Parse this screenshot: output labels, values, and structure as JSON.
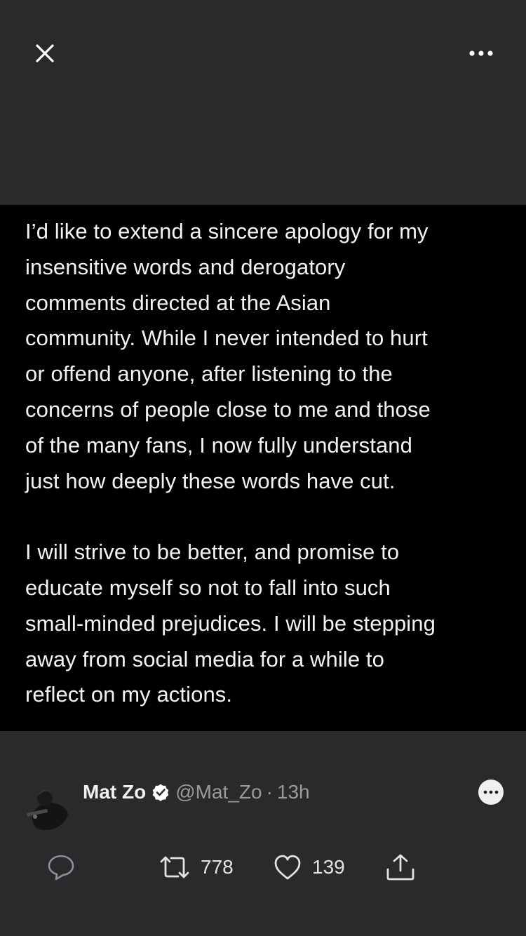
{
  "header": {
    "close_icon": "close-icon",
    "more_icon": "more-horizontal-icon"
  },
  "media": {
    "text": "I’d like to extend a sincere apology for my\ninsensitive words and derogatory\ncomments directed at the Asian\ncommunity. While I never intended to hurt\nor offend anyone, after listening to the\nconcerns of people close to me and those\nof the many fans, I now fully understand\njust how deeply these words have cut.\n\nI will strive to be better, and promise to\neducate myself so not to fall into such\nsmall-minded prejudices. I will be stepping\naway from social media for a while to\nreflect on my actions."
  },
  "tweet": {
    "author_name": "Mat Zo",
    "verified": true,
    "handle": "@Mat_Zo",
    "separator": "·",
    "time": "13h"
  },
  "actions": {
    "reply_icon": "reply-icon",
    "retweet_icon": "retweet-icon",
    "retweet_count": "778",
    "like_icon": "heart-icon",
    "like_count": "139",
    "share_icon": "share-icon"
  },
  "colors": {
    "background": "#2a2a2c",
    "media_background": "#000000",
    "text": "#f2f2f2",
    "muted": "#9a9a9d"
  }
}
